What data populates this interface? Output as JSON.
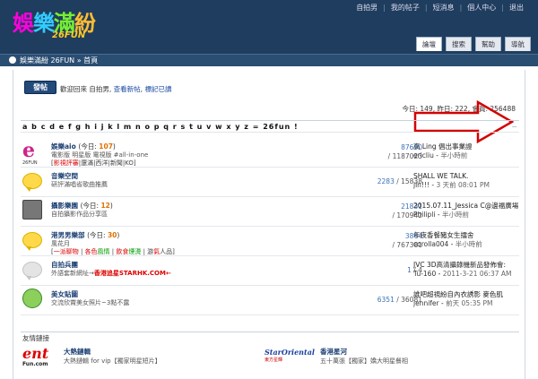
{
  "logo": {
    "chars": [
      "娛",
      "樂",
      "滿",
      "紛"
    ],
    "sub": "26FUN"
  },
  "usernav": [
    "自拍男",
    "我的帖子",
    "短消息",
    "個人中心",
    "退出"
  ],
  "tabs": [
    "論壇",
    "搜索",
    "幫助",
    "導航"
  ],
  "breadcrumb": "娛樂滿紛 26FUN » 首頁",
  "post_button": "發帖",
  "welcome": {
    "prefix": "歡迎回來 自拍男,",
    "new_posts": "查看新帖",
    "sep": ", ",
    "mark_read": "標記已讀"
  },
  "stats": "今日: 149, 昨日: 222, 會員: 256488",
  "alphabet": "a b c d e f g h i j k l m n o p q r s t u v w x y z = 26fun !",
  "alphabet_collapse": "−",
  "forums": [
    {
      "name": "娛樂aio",
      "today_label": "(今日: ",
      "today": "107",
      "today_end": ")",
      "desc": "電影版 明星版 電視版 #all-in-one",
      "sub": [
        {
          "t": "[",
          "c": ""
        },
        {
          "t": "影視評審",
          "c": "red"
        },
        {
          "t": "|",
          "c": ""
        },
        {
          "t": "還滿",
          "c": ""
        },
        {
          "t": "|",
          "c": ""
        },
        {
          "t": "西洋",
          "c": ""
        },
        {
          "t": "|",
          "c": ""
        },
        {
          "t": "新聞",
          "c": ""
        },
        {
          "t": "|",
          "c": ""
        },
        {
          "t": "KO",
          "c": ""
        },
        {
          "t": "]",
          "c": ""
        }
      ],
      "threads": "87690",
      "posts": "1187023",
      "last_title": "高 Ling 倡出事業證",
      "last_by": "ericliu",
      "last_time": "半小時前",
      "icon": "fun-e"
    },
    {
      "name": "音樂空間",
      "today_label": "",
      "today": "",
      "today_end": "",
      "desc": "研評滿唱省歌曲推薦",
      "sub": [],
      "threads": "2283",
      "posts": "15838",
      "inline": true,
      "last_title": "SHALL WE TALK.",
      "last_by": "jin!!!",
      "last_time": "3 天前 08:01 PM",
      "icon": "bubble-yellow"
    },
    {
      "name": "攝影樂園",
      "today_label": "(今日: ",
      "today": "12",
      "today_end": ")",
      "desc": "自拍攝影作品分享區",
      "sub": [],
      "threads": "21831",
      "posts": "170942",
      "last_title": "2015.07.11_Jessica C@邊福廣場",
      "last_by": "Philipli",
      "last_time": "半小時前",
      "icon": "camera"
    },
    {
      "name": "港男男樂部",
      "today_label": "(今日: ",
      "today": "30",
      "today_end": ")",
      "desc": "風花月",
      "sub": [
        {
          "t": "[",
          "c": ""
        },
        {
          "t": "一派聊物",
          "c": "red"
        },
        {
          "t": " | ",
          "c": ""
        },
        {
          "t": "各色",
          "c": "red"
        },
        {
          "t": "風情",
          "c": "grn"
        },
        {
          "t": " | ",
          "c": ""
        },
        {
          "t": "飲食",
          "c": "red"
        },
        {
          "t": "煙燙",
          "c": "grn"
        },
        {
          "t": " | ",
          "c": ""
        },
        {
          "t": "游",
          "c": ""
        },
        {
          "t": "氣",
          "c": "red"
        },
        {
          "t": "人品",
          "c": ""
        },
        {
          "t": "]",
          "c": ""
        }
      ],
      "threads": "3864",
      "posts": "767381",
      "last_title": "年夜香餐豬女生擂舍",
      "last_by": "corolla004",
      "last_time": "半小時前",
      "icon": "bubble-yellow"
    },
    {
      "name": "自拍兵團",
      "today_label": "",
      "today": "",
      "today_end": "",
      "desc": "外語套新網址→",
      "desc_red": "香港追星STARHK.COM←",
      "sub": [],
      "threads": "1",
      "posts": "4",
      "inline": true,
      "last_title": "JVC 3D高清攝錄機新品發佈會:",
      "last_by": "Tu-160",
      "last_time": "2011-3-21 06:37 AM",
      "icon": "bubble-grey"
    },
    {
      "name": "美女貼圖",
      "today_label": "",
      "today": "",
      "today_end": "",
      "desc": "交流欣賞美女照片~3點不露",
      "sub": [],
      "threads": "6351",
      "posts": "36081",
      "inline": true,
      "last_title": "誰吧超視紛自內衣誘影 麥色肌",
      "last_by": "jennifer",
      "last_time": "前天 05:35 PM",
      "icon": "kid"
    }
  ],
  "friend_links_label": "友情鏈接",
  "links": [
    {
      "logo_a": "ent",
      "logo_b": "Fun.com",
      "title": "大熱鏈輯",
      "desc": "大熱鏈輯 for vip【獨家明星短片】"
    },
    {
      "logo_a": "StarOriental",
      "logo_b": "東方星輝",
      "title": "香港星河",
      "desc": "五十萬張【獨家】嬌大明星餐相"
    }
  ],
  "colors": {
    "header": "#1f3d5e",
    "crumb": "#2a4d72",
    "accent": "#1b3f73",
    "arrow": "#d40000"
  }
}
